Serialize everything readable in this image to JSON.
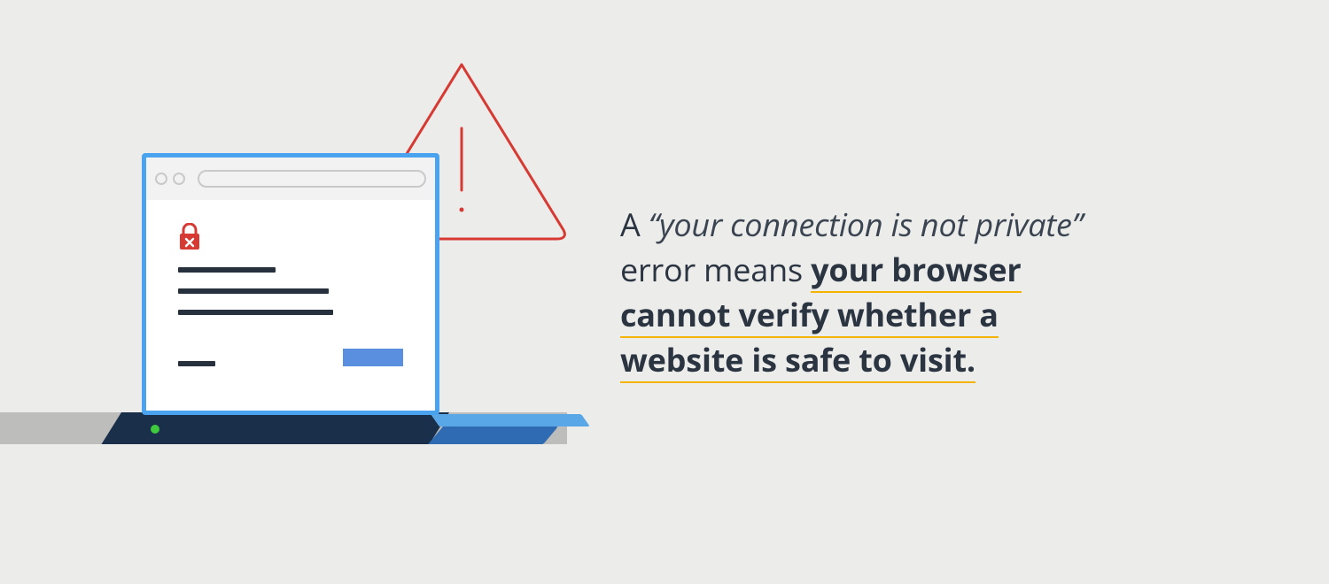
{
  "definition": {
    "prefix": "A ",
    "quote_open": "“",
    "quote_text": "your connection is not private",
    "quote_close": "”",
    "mid": " error means ",
    "bold1": "your browser ",
    "bold2": "cannot verify whether a ",
    "bold3": "website is safe to visit."
  },
  "colors": {
    "background": "#ececea",
    "accent_blue": "#4aa3ef",
    "warn_red": "#d63a33",
    "underline": "#f4b400"
  },
  "icons": {
    "warning": "warning-triangle-icon",
    "lock": "lock-error-icon"
  }
}
